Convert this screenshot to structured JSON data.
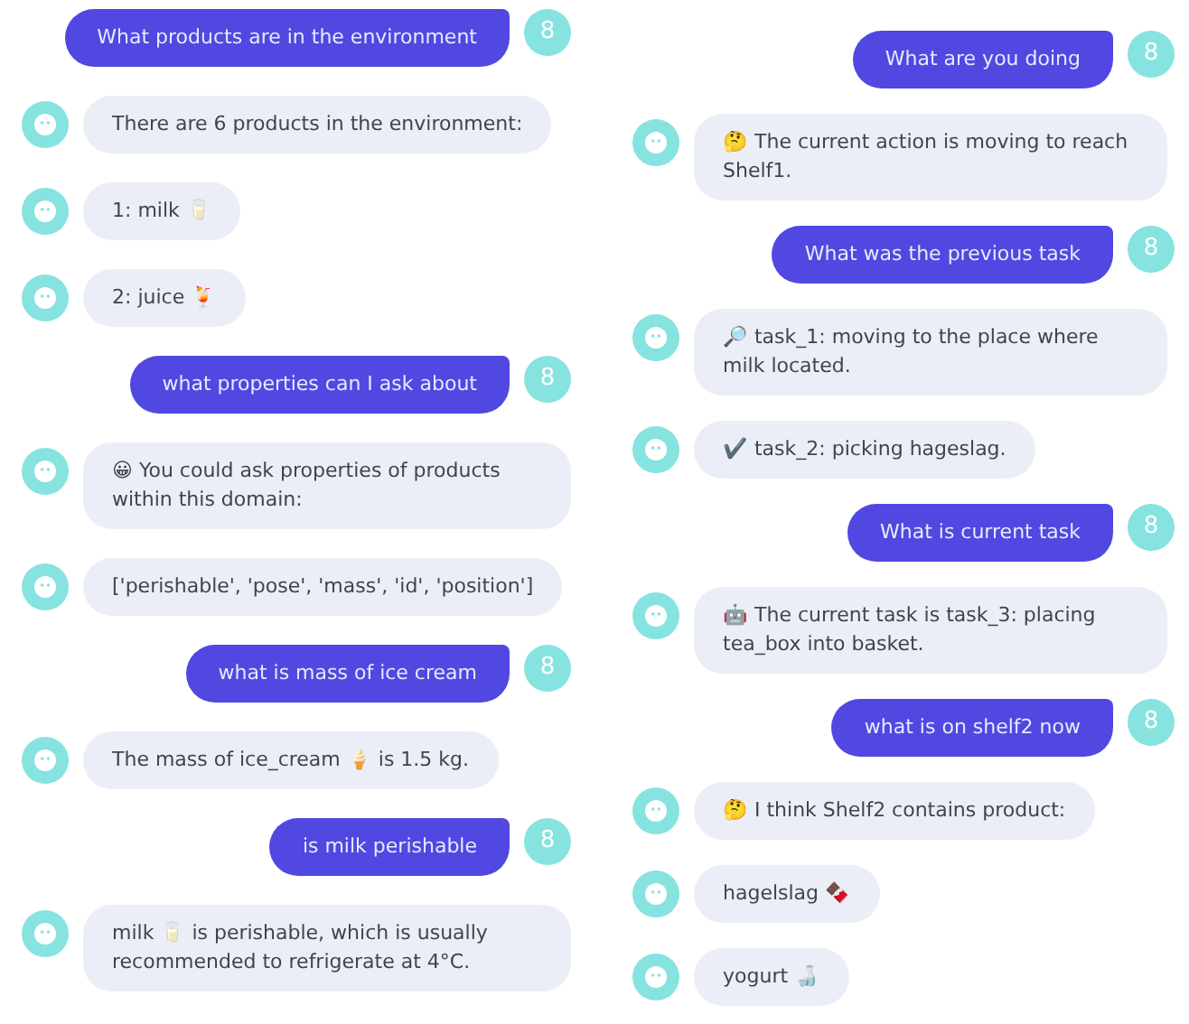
{
  "chats": [
    {
      "messages": [
        {
          "kind": "user",
          "text": "What products are in the environment",
          "avatar": "8"
        },
        {
          "kind": "bot",
          "text": "There are 6 products in the environment:"
        },
        {
          "kind": "bot",
          "text": "1: milk 🥛"
        },
        {
          "kind": "bot",
          "text": "2: juice 🍹"
        },
        {
          "kind": "user",
          "text": "what properties can I ask about",
          "avatar": "8"
        },
        {
          "kind": "bot",
          "text": "😀 You could ask properties of products within this domain:"
        },
        {
          "kind": "bot",
          "text": "['perishable', 'pose', 'mass', 'id', 'position']"
        },
        {
          "kind": "user",
          "text": "what is mass of ice cream",
          "avatar": "8"
        },
        {
          "kind": "bot",
          "text": "The mass of ice_cream 🍦 is 1.5 kg."
        },
        {
          "kind": "user",
          "text": "is milk perishable",
          "avatar": "8"
        },
        {
          "kind": "bot",
          "text": "milk 🥛 is perishable, which is usually recommended to refrigerate at 4°C."
        }
      ]
    },
    {
      "messages": [
        {
          "kind": "user",
          "text": "What are you doing",
          "avatar": "8"
        },
        {
          "kind": "bot",
          "text": "🤔 The current action is moving to reach Shelf1."
        },
        {
          "kind": "user",
          "text": "What was the previous task",
          "avatar": "8"
        },
        {
          "kind": "bot",
          "text": "🔎 task_1: moving to the place where milk located."
        },
        {
          "kind": "bot",
          "text": "✔️ task_2: picking hageslag."
        },
        {
          "kind": "user",
          "text": "What is current task",
          "avatar": "8"
        },
        {
          "kind": "bot",
          "text": "🤖 The current task is task_3: placing tea_box into basket."
        },
        {
          "kind": "user",
          "text": "what is on shelf2 now",
          "avatar": "8"
        },
        {
          "kind": "bot",
          "text": "🤔 I think Shelf2 contains product:"
        },
        {
          "kind": "bot",
          "text": "hagelslag 🍫"
        },
        {
          "kind": "bot",
          "text": "yogurt 🍶"
        }
      ]
    }
  ]
}
